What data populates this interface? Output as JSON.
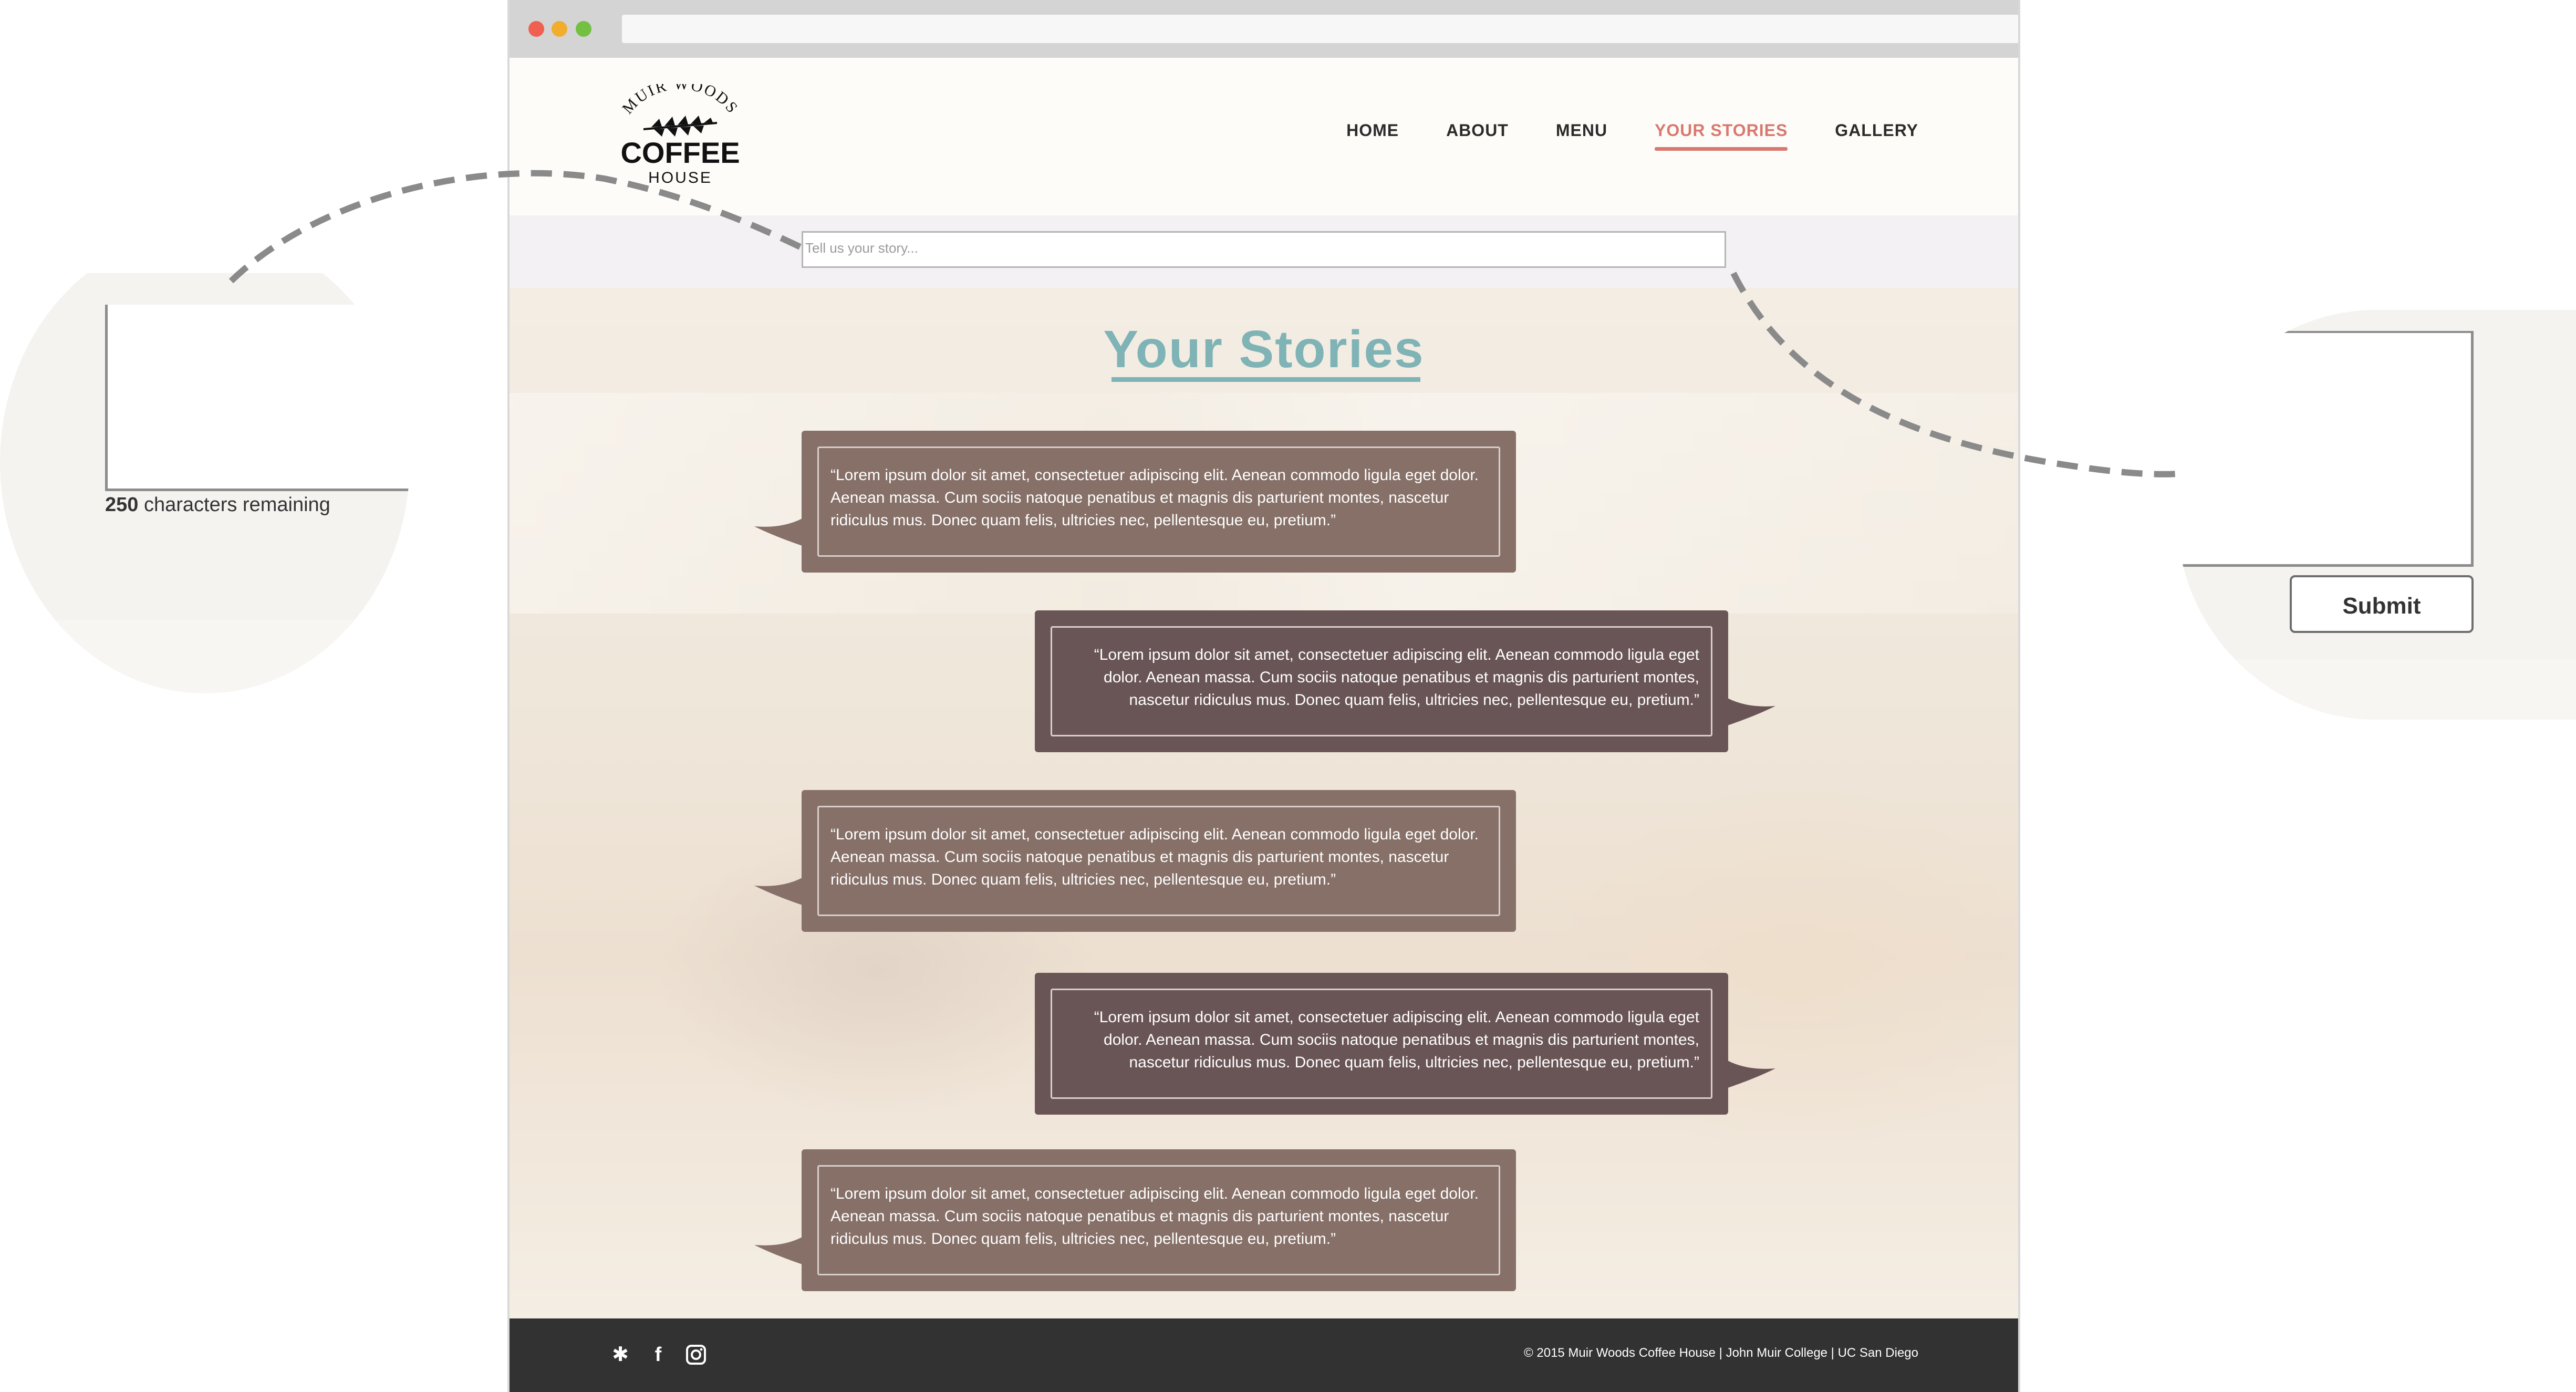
{
  "nav": {
    "items": [
      {
        "label": "HOME",
        "active": false
      },
      {
        "label": "ABOUT",
        "active": false
      },
      {
        "label": "MENU",
        "active": false
      },
      {
        "label": "YOUR STORIES",
        "active": true
      },
      {
        "label": "GALLERY",
        "active": false
      }
    ]
  },
  "logo": {
    "line1": "MUIR WOODS",
    "line2": "COFFEE",
    "line3": "HOUSE"
  },
  "story_input": {
    "placeholder": "Tell us your story..."
  },
  "page_title": "Your Stories",
  "stories": [
    {
      "text": "“Lorem ipsum dolor sit amet, consectetuer adipiscing elit. Aenean commodo ligula eget dolor. Aenean massa. Cum sociis natoque penatibus et magnis dis parturient montes, nascetur ridiculus mus. Donec quam felis, ultricies nec, pellentesque eu, pretium.”",
      "side": "left"
    },
    {
      "text": "“Lorem ipsum dolor sit amet, consectetuer adipiscing elit. Aenean commodo ligula eget dolor. Aenean massa. Cum sociis natoque penatibus et magnis dis parturient montes, nascetur ridiculus mus. Donec quam felis, ultricies nec, pellentesque eu, pretium.”",
      "side": "right"
    },
    {
      "text": "“Lorem ipsum dolor sit amet, consectetuer adipiscing elit. Aenean commodo ligula eget dolor. Aenean massa. Cum sociis natoque penatibus et magnis dis parturient montes, nascetur ridiculus mus. Donec quam felis, ultricies nec, pellentesque eu, pretium.”",
      "side": "left"
    },
    {
      "text": "“Lorem ipsum dolor sit amet, consectetuer adipiscing elit. Aenean commodo ligula eget dolor. Aenean massa. Cum sociis natoque penatibus et magnis dis parturient montes, nascetur ridiculus mus. Donec quam felis, ultricies nec, pellentesque eu, pretium.”",
      "side": "right"
    },
    {
      "text": "“Lorem ipsum dolor sit amet, consectetuer adipiscing elit. Aenean commodo ligula eget dolor. Aenean massa. Cum sociis natoque penatibus et magnis dis parturient montes, nascetur ridiculus mus. Donec quam felis, ultricies nec, pellentesque eu, pretium.”",
      "side": "left"
    }
  ],
  "footer": {
    "copyright": "© 2015 Muir Woods Coffee House | John Muir College | UC San Diego",
    "social_icons": [
      "yelp-icon",
      "facebook-icon",
      "instagram-icon"
    ]
  },
  "callout_left": {
    "count": "250",
    "count_label": " characters remaining"
  },
  "callout_right": {
    "submit_label": "Submit"
  },
  "colors": {
    "accent": "#d9786f",
    "title": "#7fb3b5",
    "bubble_light": "#867068",
    "bubble_dark": "#6a5556",
    "footer": "#323232"
  }
}
